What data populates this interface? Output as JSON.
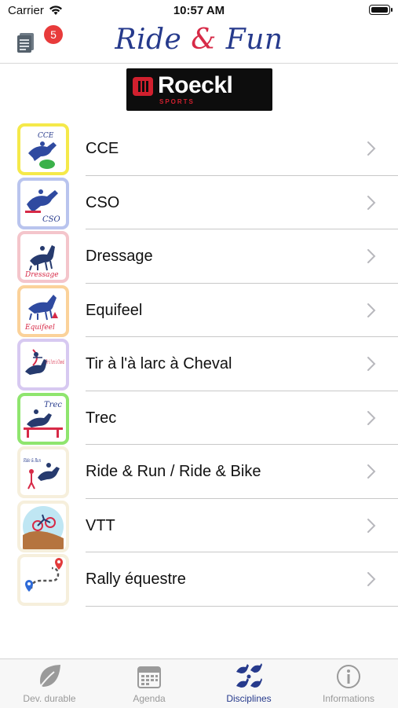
{
  "status_bar": {
    "carrier": "Carrier",
    "time": "10:57 AM"
  },
  "nav": {
    "title_part1": "Ride ",
    "title_amp": "&",
    "title_part2": " Fun",
    "badge_count": "5"
  },
  "sponsor": {
    "name": "Roeckl",
    "sub": "SPORTS"
  },
  "disciplines": [
    {
      "label": "CCE",
      "thumb_text": "CCE",
      "frame_color": "#f5e94a",
      "icon": "cross-country-horse-icon"
    },
    {
      "label": "CSO",
      "thumb_text": "CSO",
      "frame_color": "#b9c4ee",
      "icon": "show-jumping-horse-icon"
    },
    {
      "label": "Dressage",
      "thumb_text": "Dressage",
      "frame_color": "#f4c5cb",
      "icon": "dressage-horse-icon"
    },
    {
      "label": "Equifeel",
      "thumb_text": "Equifeel",
      "frame_color": "#fbd29a",
      "icon": "equifeel-horse-icon"
    },
    {
      "label": "Tir à l'à larc à Cheval",
      "thumb_text": "Tir à l'arc à Cheval",
      "frame_color": "#d7c9f1",
      "icon": "archery-horse-icon"
    },
    {
      "label": "Trec",
      "thumb_text": "Trec",
      "frame_color": "#8fe56e",
      "icon": "trec-horse-icon"
    },
    {
      "label": "Ride & Run / Ride & Bike",
      "thumb_text": "Ride & Run",
      "frame_color": "#f6efdc",
      "icon": "ride-and-run-icon"
    },
    {
      "label": "VTT",
      "thumb_text": "",
      "frame_color": "#f6efdc",
      "icon": "mountain-bike-icon"
    },
    {
      "label": "Rally équestre",
      "thumb_text": "",
      "frame_color": "#f6efdc",
      "icon": "route-map-icon"
    }
  ],
  "tabs": [
    {
      "label": "Dev. durable",
      "icon": "leaf-icon",
      "active": false
    },
    {
      "label": "Agenda",
      "icon": "calendar-icon",
      "active": false
    },
    {
      "label": "Disciplines",
      "icon": "disciplines-icon",
      "active": true
    },
    {
      "label": "Informations",
      "icon": "info-icon",
      "active": false
    }
  ],
  "colors": {
    "brand_blue": "#263a8c",
    "brand_red": "#d72a47",
    "badge_red": "#e83b3b",
    "tab_inactive": "#999999"
  }
}
